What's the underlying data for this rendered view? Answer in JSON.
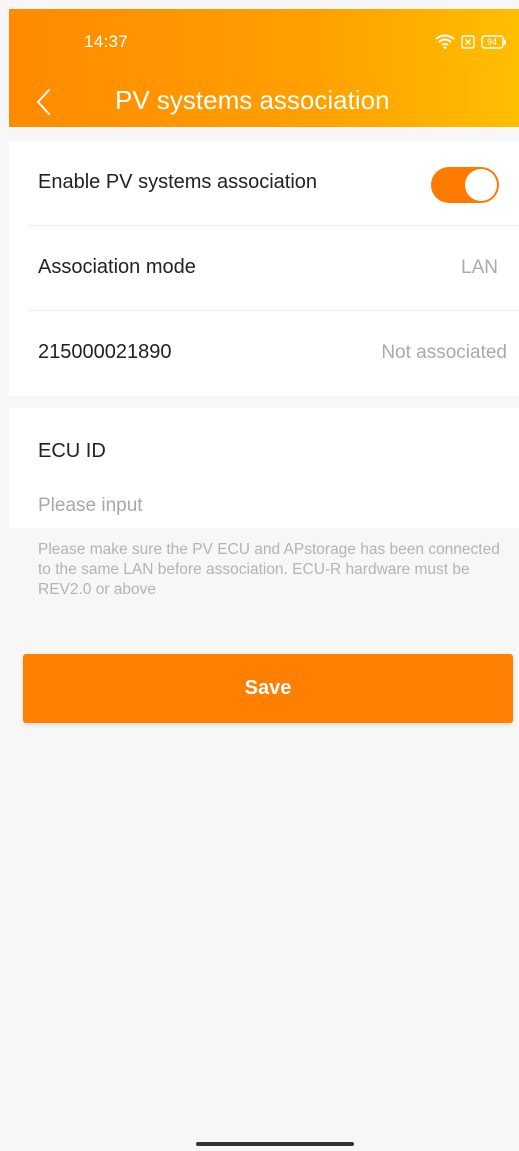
{
  "status_bar": {
    "time": "14:37",
    "battery": "94",
    "icons": [
      "wifi-icon",
      "sim-icon",
      "battery-icon"
    ]
  },
  "header": {
    "title": "PV systems association",
    "back_icon": "chevron-left-icon"
  },
  "settings": {
    "enable_label": "Enable PV systems association",
    "enable_state": "on",
    "mode_label": "Association mode",
    "mode_value": "LAN",
    "device_id": "215000021890",
    "device_status": "Not associated"
  },
  "ecu": {
    "label": "ECU ID",
    "placeholder": "Please input",
    "value": ""
  },
  "hint": "Please make sure the PV ECU and APstorage has been connected to the same LAN before association. ECU-R hardware must be REV2.0 or above",
  "save_label": "Save",
  "colors": {
    "accent": "#ff7f00",
    "header_start": "#ff8a00",
    "header_end": "#ffbe00",
    "background": "#f7f7f7"
  }
}
